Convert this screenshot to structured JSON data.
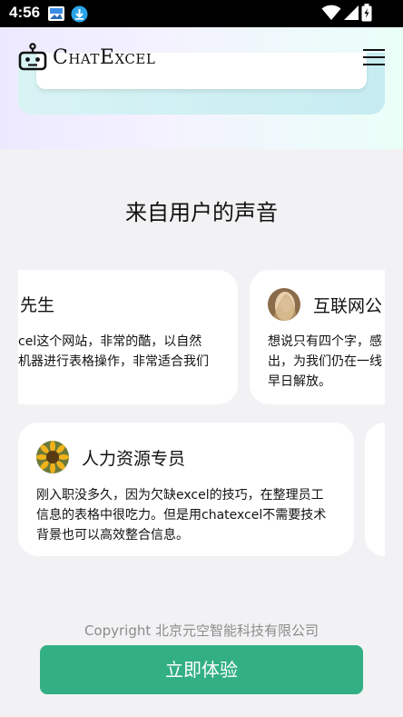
{
  "status_bar": {
    "time": "4:56"
  },
  "header": {
    "brand": "ChatExcel"
  },
  "section": {
    "title": "来自用户的声音"
  },
  "testimonials_row1": [
    {
      "name": "先生",
      "lines": [
        "cel这个网站，非常的酷，以自然",
        "机器进行表格操作，非常适合我们"
      ]
    },
    {
      "name": "互联网公",
      "lines": [
        "想说只有四个字，感",
        "出，为我们仍在一线",
        "早日解放。"
      ]
    }
  ],
  "testimonials_row2": [
    {
      "name": "人力资源专员",
      "lines": [
        "刚入职没多久，因为欠缺excel的技巧，在整理员工",
        "信息的表格中很吃力。但是用chatexcel不需要技术",
        "背景也可以高效整合信息。"
      ]
    }
  ],
  "footer": {
    "copyright": "Copyright 北京元空智能科技有限公司"
  },
  "cta": {
    "label": "立即体验"
  },
  "colors": {
    "accent": "#33af84",
    "status_bar": "#000000"
  },
  "icons": [
    "gallery-icon",
    "download-icon",
    "wifi-icon",
    "signal-icon",
    "battery-icon",
    "robot-logo-icon",
    "menu-icon"
  ]
}
